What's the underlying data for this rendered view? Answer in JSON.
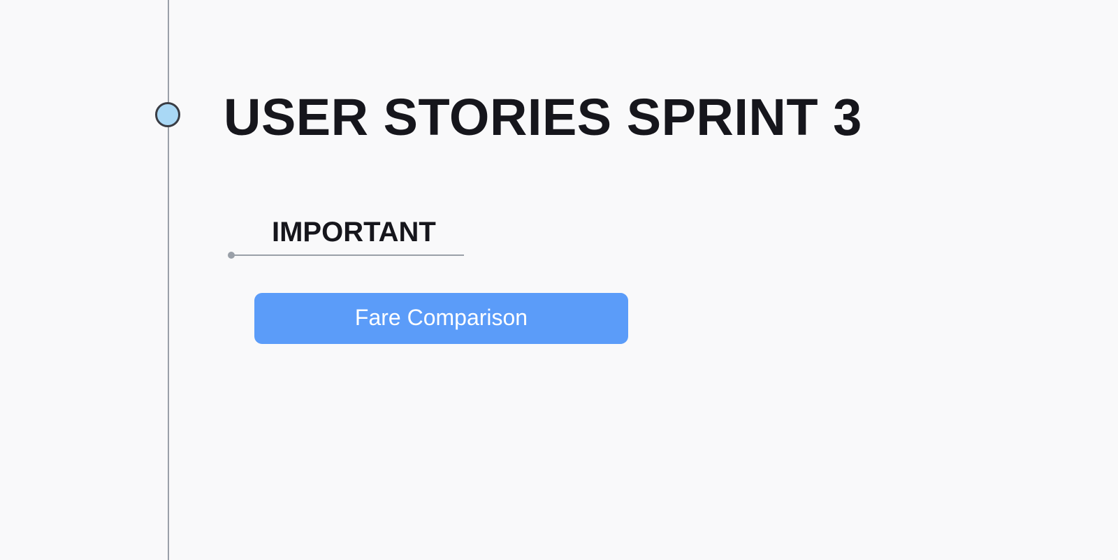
{
  "title": "USER STORIES SPRINT 3",
  "sections": [
    {
      "label": "IMPORTANT",
      "items": [
        {
          "label": "Fare Comparison"
        }
      ]
    }
  ],
  "colors": {
    "background": "#f9f9fa",
    "timeline": "#9aa0a8",
    "node_fill": "#a9d8f5",
    "node_stroke": "#3a3d44",
    "text": "#16161c",
    "card": "#5b9cf9",
    "card_text": "#ffffff"
  }
}
